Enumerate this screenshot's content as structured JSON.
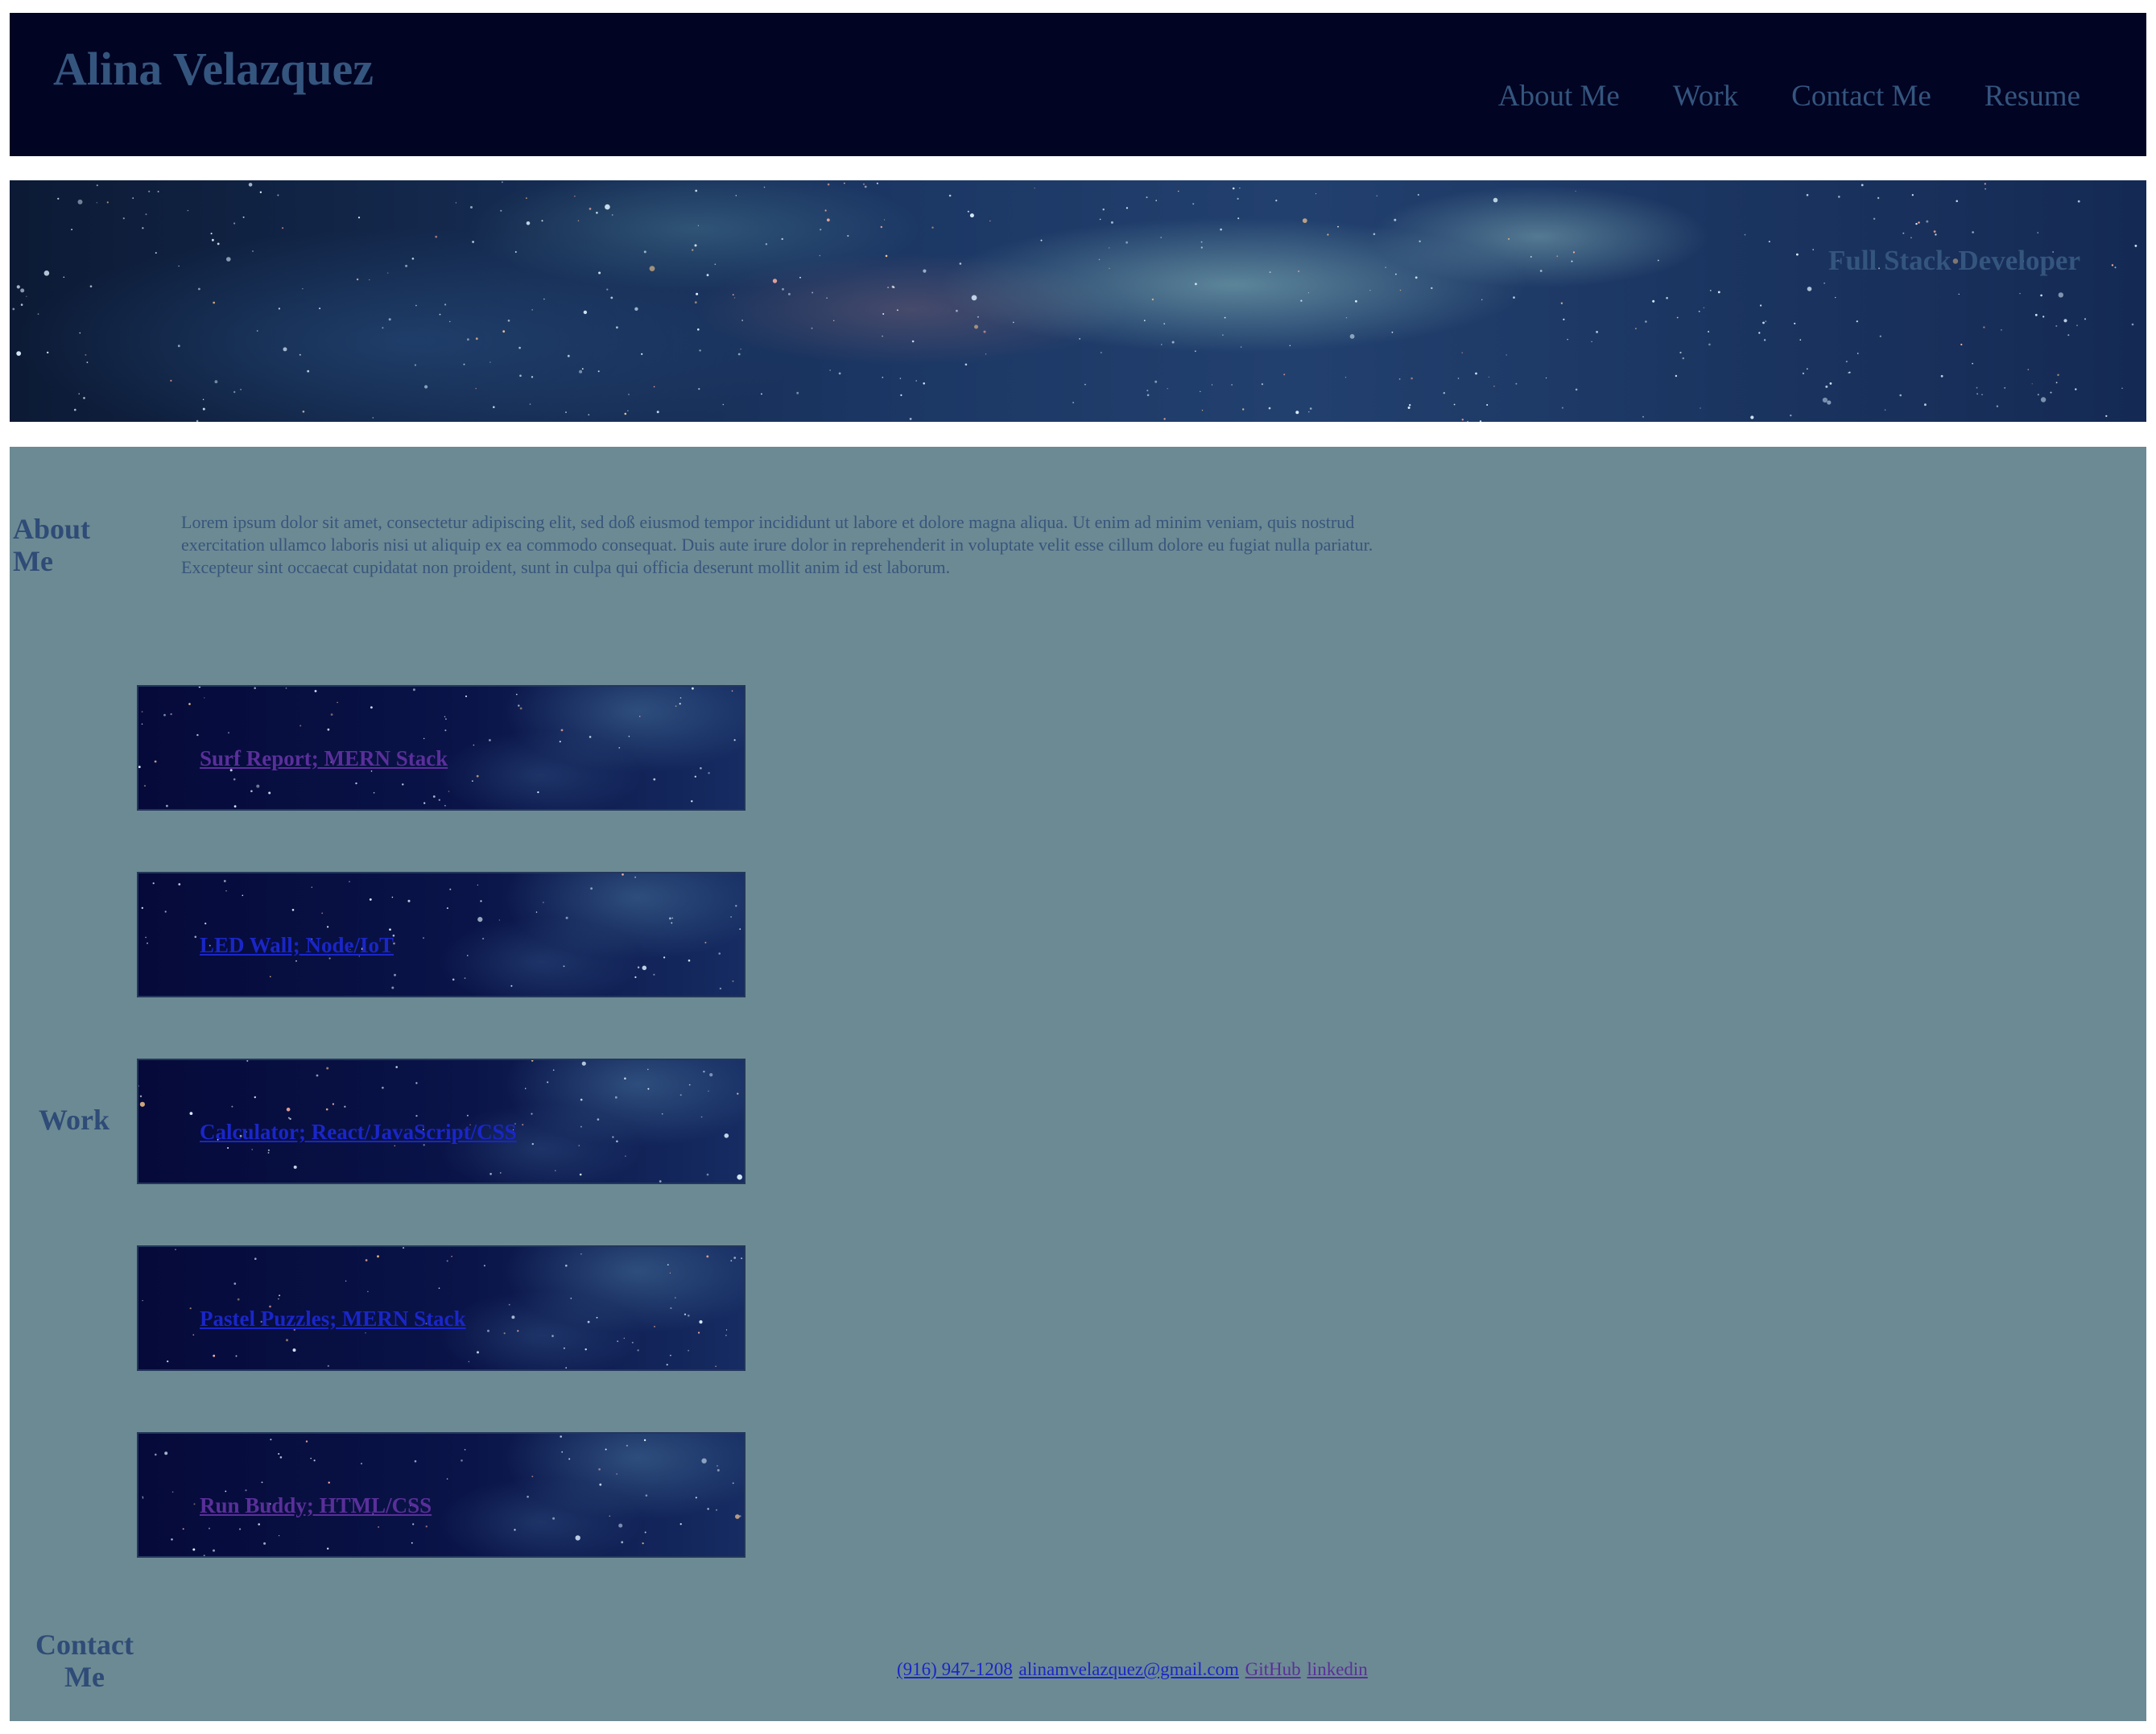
{
  "header": {
    "title": "Alina Velazquez",
    "nav": [
      "About Me",
      "Work",
      "Contact Me",
      "Resume"
    ]
  },
  "hero": {
    "tagline": "Full Stack Developer"
  },
  "about": {
    "heading": "About Me",
    "text": "Lorem ipsum dolor sit amet, consectetur adipiscing elit, sed doß eiusmod tempor incididunt ut labore et dolore magna aliqua. Ut enim ad minim veniam, quis nostrud exercitation ullamco laboris nisi ut aliquip ex ea commodo consequat. Duis aute irure dolor in reprehenderit in voluptate velit esse cillum dolore eu fugiat nulla pariatur. Excepteur sint occaecat cupidatat non proident, sunt in culpa qui officia deserunt mollit anim id est laborum."
  },
  "work": {
    "heading": "Work",
    "projects": [
      {
        "label": "Surf Report; MERN Stack",
        "link_state": "visited"
      },
      {
        "label": "LED Wall; Node/IoT",
        "link_state": "unvisited"
      },
      {
        "label": "Calculator; React/JavaScript/CSS",
        "link_state": "unvisited"
      },
      {
        "label": "Pastel Puzzles; MERN Stack",
        "link_state": "unvisited"
      },
      {
        "label": "Run Buddy; HTML/CSS",
        "link_state": "visited"
      }
    ]
  },
  "contact": {
    "heading": "Contact Me",
    "phone": "(916) 947-1208",
    "email": "alinamvelazquez@gmail.com",
    "github": "GitHub",
    "linkedin": "linkedin"
  },
  "colors": {
    "header_bg": "#020423",
    "main_bg": "#6c8a93",
    "text_blue": "#34557e",
    "visited_link": "#5a2f9a",
    "unvisited_link": "#1a26c8"
  }
}
